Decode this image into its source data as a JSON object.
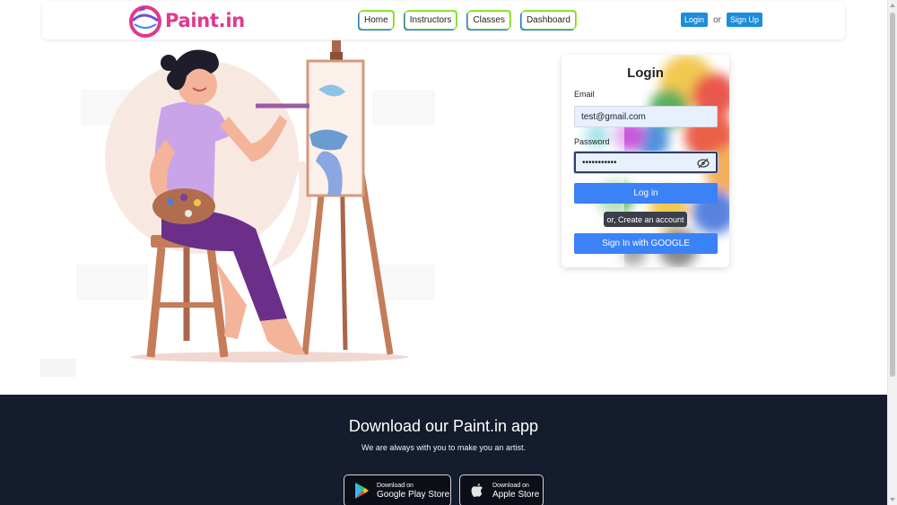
{
  "brand": {
    "name": "Paint.in"
  },
  "nav": {
    "links": [
      "Home",
      "Instructors",
      "Classes",
      "Dashboard"
    ],
    "login_label": "Login",
    "or_label": "or",
    "signup_label": "Sign Up"
  },
  "login": {
    "title": "Login",
    "email_label": "Email",
    "email_value": "test@gmail.com",
    "password_label": "Password",
    "password_mask": "•••••••••••",
    "login_button": "Log in",
    "create_account": "or, Create an account",
    "google_button": "Sign In with GOOGLE"
  },
  "download": {
    "title": "Download our Paint.in app",
    "subtitle": "We are always with you to make you an artist.",
    "google_play": {
      "small": "Download on",
      "big": "Google Play Store"
    },
    "apple_store": {
      "small": "Download on",
      "big": "Apple Store"
    }
  },
  "colors": {
    "accent": "#3b82f6",
    "brand_pink": "#e0398f",
    "nav_auth": "#1c8ddb",
    "footer_bg": "#141c2e"
  }
}
